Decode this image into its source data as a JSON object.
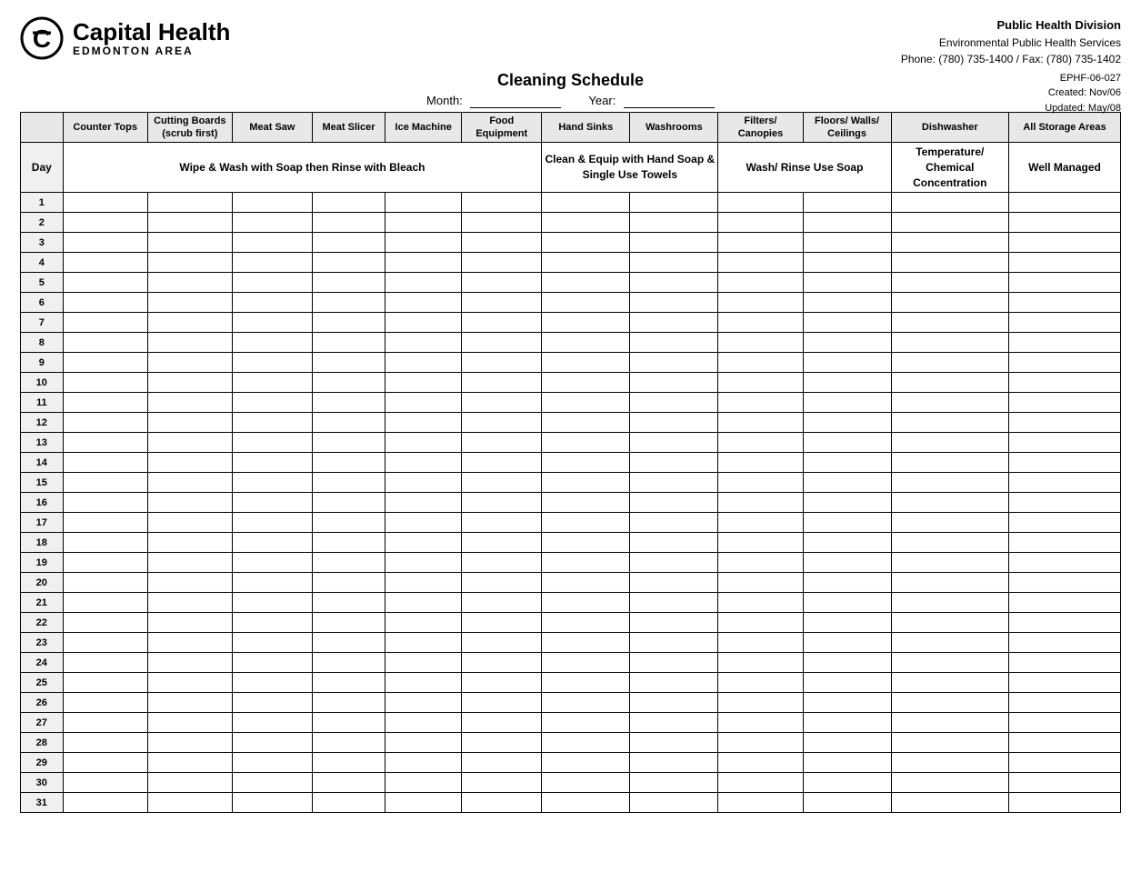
{
  "header": {
    "logo_main": "Capital Health",
    "logo_sub": "EDMONTON AREA",
    "division_title": "Public Health Division",
    "division_line2": "Environmental Public Health Services",
    "division_phone": "Phone: (780) 735-1400 / Fax: (780) 735-1402",
    "doc_id": "EPHF-06-027",
    "doc_created": "Created: Nov/06",
    "doc_updated": "Updated: May/08"
  },
  "title": "Cleaning Schedule",
  "month_label": "Month:",
  "year_label": "Year:",
  "columns": [
    {
      "id": "day",
      "label": ""
    },
    {
      "id": "counter",
      "label": "Counter Tops"
    },
    {
      "id": "cutting",
      "label": "Cutting Boards (scrub first)"
    },
    {
      "id": "meatsaw",
      "label": "Meat Saw"
    },
    {
      "id": "meatslicer",
      "label": "Meat Slicer"
    },
    {
      "id": "ice",
      "label": "Ice Machine"
    },
    {
      "id": "food",
      "label": "Food Equipment"
    },
    {
      "id": "handsinks",
      "label": "Hand Sinks"
    },
    {
      "id": "washrooms",
      "label": "Washrooms"
    },
    {
      "id": "filters",
      "label": "Filters/ Canopies"
    },
    {
      "id": "floors",
      "label": "Floors/ Walls/ Ceilings"
    },
    {
      "id": "dishwasher",
      "label": "Dishwasher"
    },
    {
      "id": "storage",
      "label": "All Storage Areas"
    }
  ],
  "instruction_row": {
    "day_label": "Day",
    "wipe_instruction": "Wipe & Wash with Soap then Rinse with Bleach",
    "clean_instruction": "Clean & Equip with Hand Soap & Single Use Towels",
    "wash_instruction": "Wash/ Rinse Use Soap",
    "temp_instruction": "Temperature/ Chemical Concentration",
    "well_instruction": "Well Managed"
  },
  "days": [
    1,
    2,
    3,
    4,
    5,
    6,
    7,
    8,
    9,
    10,
    11,
    12,
    13,
    14,
    15,
    16,
    17,
    18,
    19,
    20,
    21,
    22,
    23,
    24,
    25,
    26,
    27,
    28,
    29,
    30,
    31
  ]
}
